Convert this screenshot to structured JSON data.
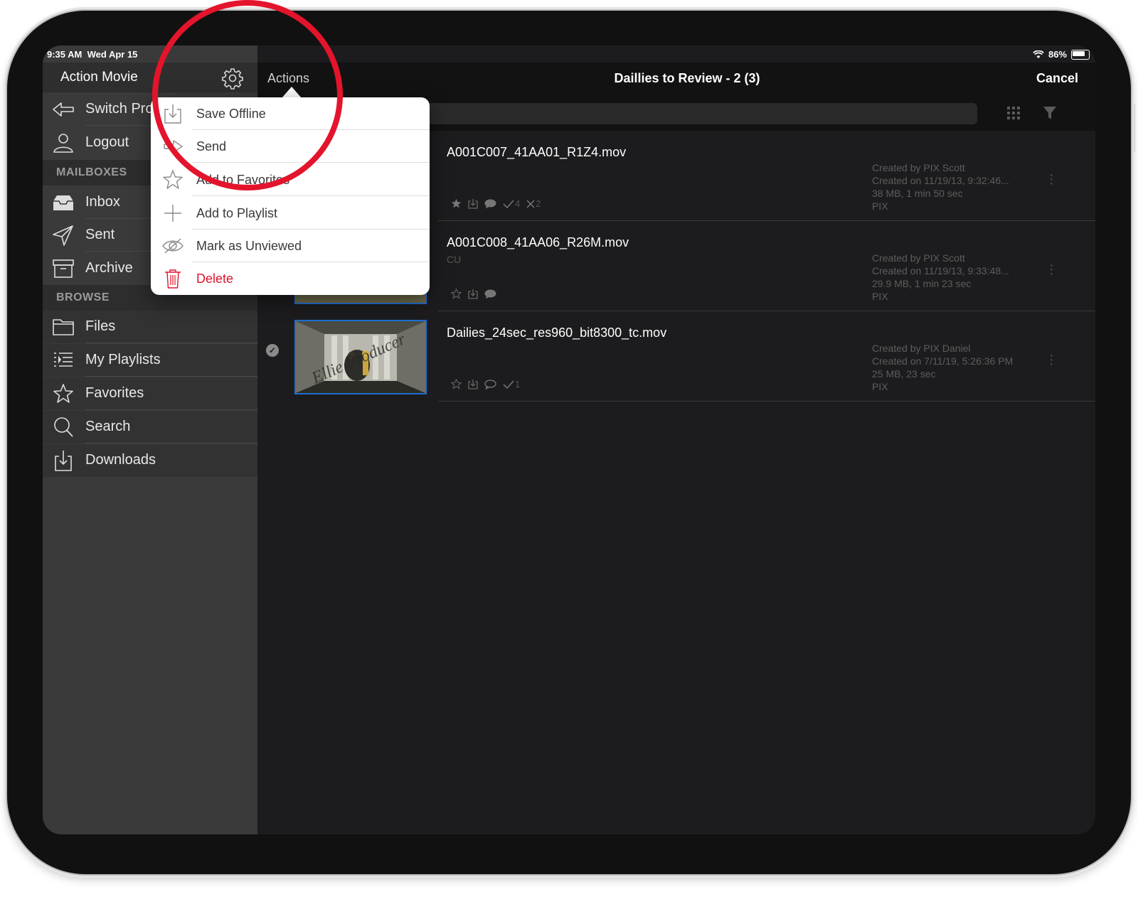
{
  "status_bar": {
    "time": "9:35 AM",
    "date": "Wed Apr 15",
    "battery": "86%"
  },
  "sidebar": {
    "title": "Action Movie",
    "top_items": [
      {
        "label": "Switch Pro",
        "icon": "switch-icon"
      },
      {
        "label": "Logout",
        "icon": "user-icon"
      }
    ],
    "mailboxes_header": "MAILBOXES",
    "mailboxes": [
      {
        "label": "Inbox",
        "icon": "inbox-icon"
      },
      {
        "label": "Sent",
        "icon": "paper-plane-icon"
      },
      {
        "label": "Archive",
        "icon": "archive-box-icon"
      }
    ],
    "browse_header": "BROWSE",
    "browse": [
      {
        "label": "Files",
        "icon": "folder-icon"
      },
      {
        "label": "My Playlists",
        "icon": "playlist-icon"
      },
      {
        "label": "Favorites",
        "icon": "star-icon"
      },
      {
        "label": "Search",
        "icon": "magnifier-icon"
      },
      {
        "label": "Downloads",
        "icon": "download-icon"
      }
    ]
  },
  "navbar": {
    "actions_label": "Actions",
    "title": "Daillies to Review - 2 (3)",
    "cancel_label": "Cancel"
  },
  "actions_menu": [
    {
      "label": "Save Offline",
      "icon": "save-offline-icon"
    },
    {
      "label": "Send",
      "icon": "send-icon"
    },
    {
      "label": "Add to Favorites",
      "icon": "star-outline-icon"
    },
    {
      "label": "Add to Playlist",
      "icon": "plus-icon"
    },
    {
      "label": "Mark as Unviewed",
      "icon": "eye-slash-icon"
    },
    {
      "label": "Delete",
      "icon": "trash-icon"
    }
  ],
  "files": [
    {
      "name": "A001C007_41AA01_R1Z4.mov",
      "subtitle": "",
      "created_by": "Created by PIX Scott",
      "created_on": "Created on 11/19/13, 9:32:46...",
      "size": "38 MB, 1 min 50 sec",
      "source": "PIX",
      "approvals": "4",
      "rejections": "2"
    },
    {
      "name": "A001C008_41AA06_R26M.mov",
      "subtitle": "CU",
      "created_by": "Created by PIX Scott",
      "created_on": "Created on 11/19/13, 9:33:48...",
      "size": "29.9 MB, 1 min 23 sec",
      "source": "PIX"
    },
    {
      "name": "Dailies_24sec_res960_bit8300_tc.mov",
      "subtitle": "",
      "created_by": "Created by PIX Daniel",
      "created_on": "Created on 7/11/19, 5:26:36 PM",
      "size": "25 MB, 23 sec",
      "source": "PIX",
      "approvals": "1",
      "watermark": "Ellie Producer"
    }
  ],
  "colors": {
    "accent_blue": "#1f6fd1",
    "danger_red": "#e0142b",
    "highlight_circle": "#e3142b"
  }
}
